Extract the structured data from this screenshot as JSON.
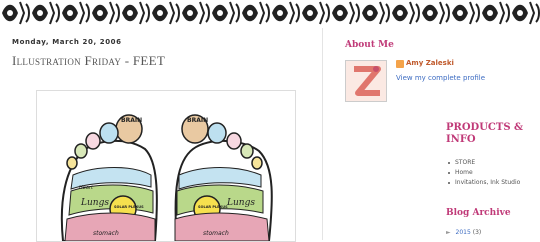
{
  "post": {
    "date": "Monday, March 20, 2006",
    "title": "Illustration Friday - FEET"
  },
  "illustration": {
    "labels": [
      "BRAIN",
      "BRAIN",
      "Heart",
      "Lungs",
      "Lungs",
      "SOLAR PLEXUS",
      "SOLAR PLEXUS",
      "stomach",
      "stomach"
    ]
  },
  "about": {
    "title": "About Me",
    "author": "Amy Zaleski",
    "profile_link": "View my complete profile"
  },
  "products": {
    "title": "PRODUCTS & INFO",
    "links": [
      "STORE",
      "Home",
      "Invitations, Ink Studio"
    ]
  },
  "archive": {
    "title": "Blog Archive",
    "toggle": "►",
    "year": "2015",
    "count": "(3)"
  },
  "colors": {
    "accent": "#c03a78",
    "link": "#3d6cc2"
  }
}
